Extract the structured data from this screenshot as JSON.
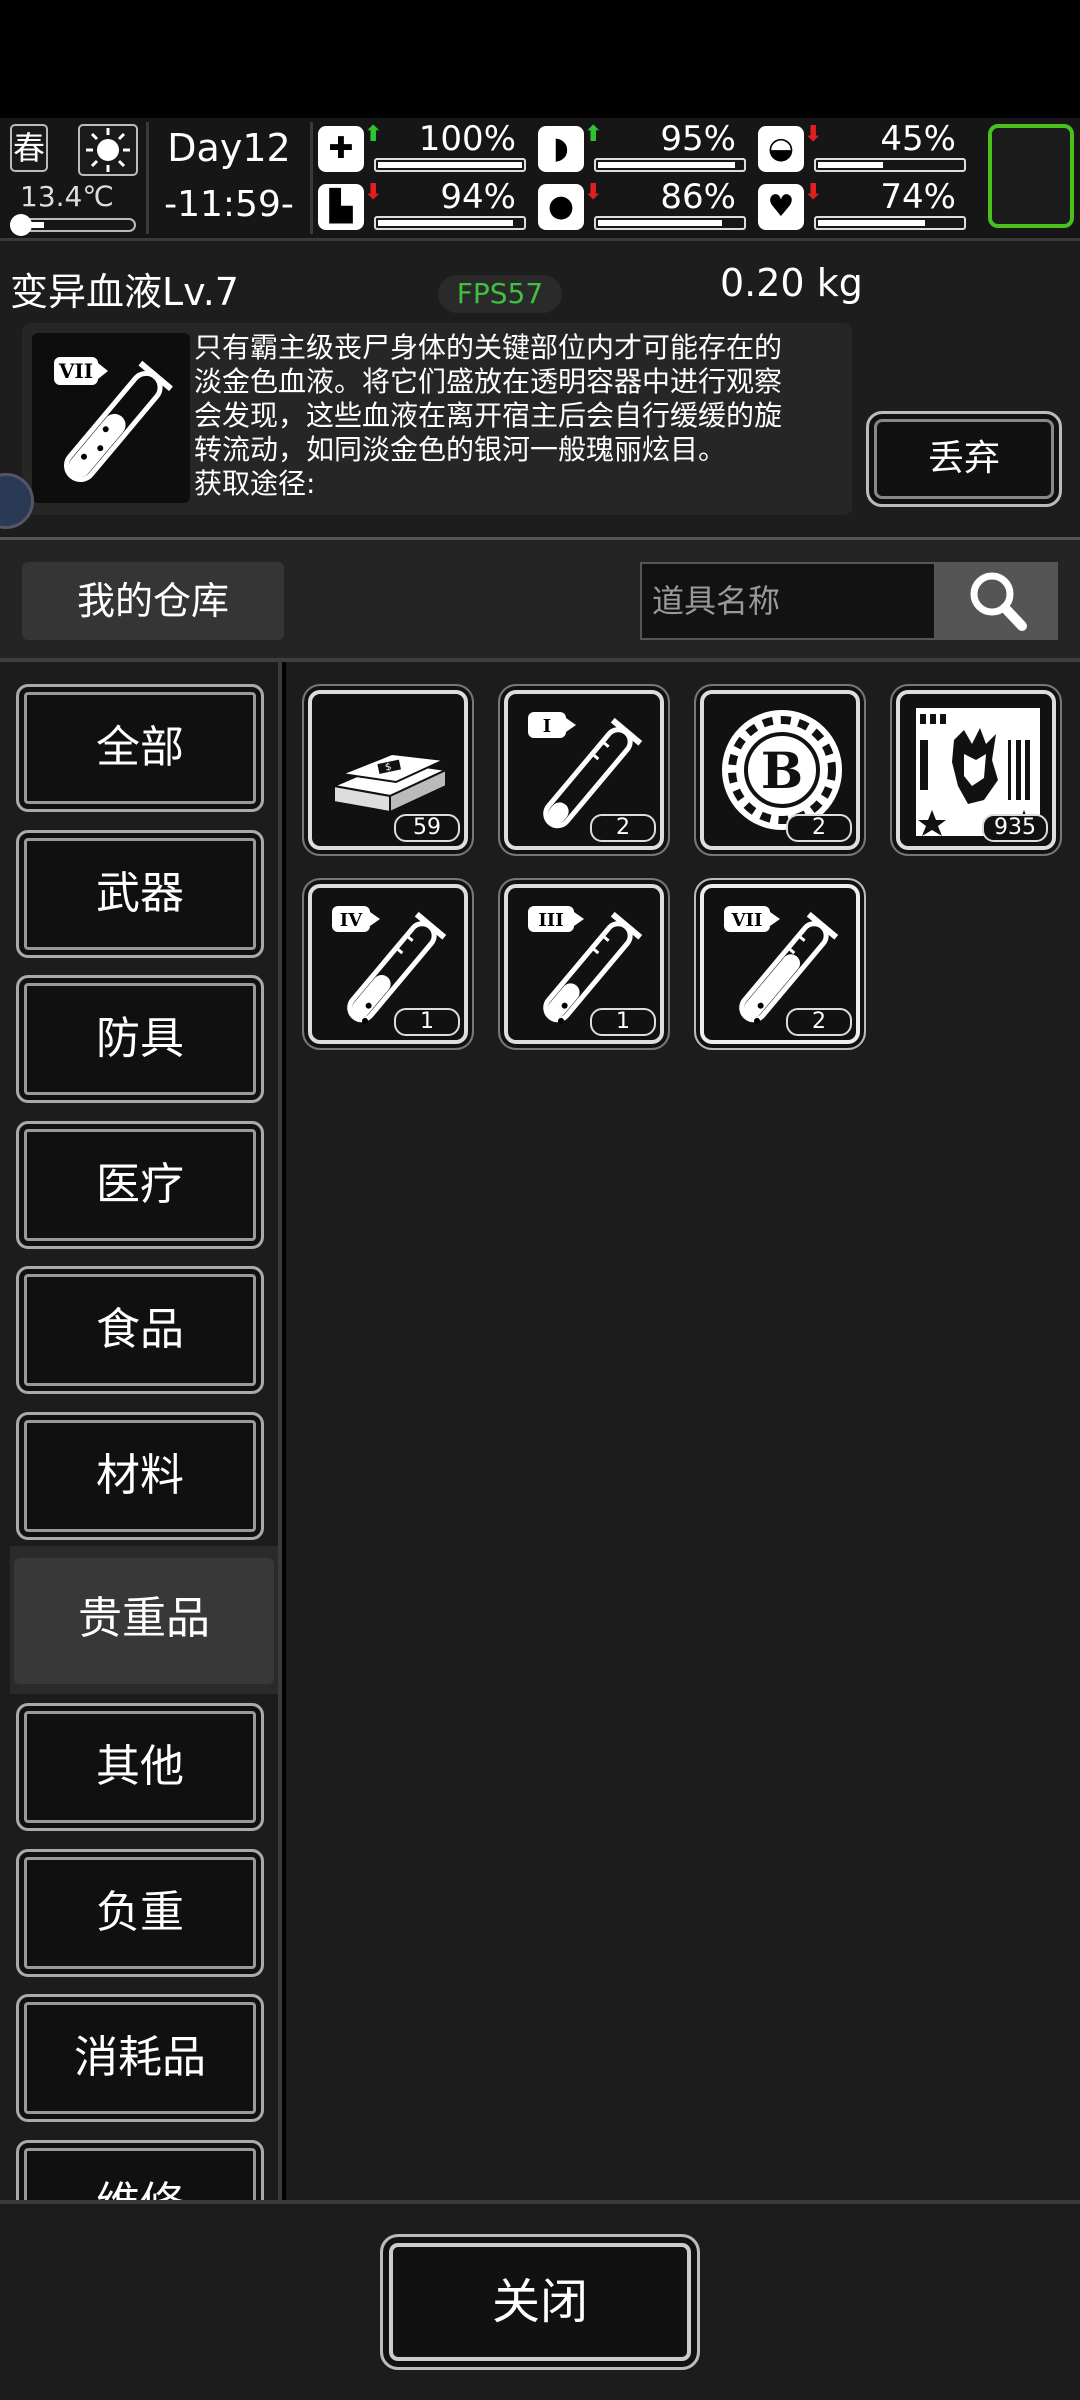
{
  "status": {
    "season": "春",
    "temperature": "13.4℃",
    "day": "Day12",
    "time": "-11:59-",
    "stats": [
      {
        "name": "health",
        "icon": "medkit-icon",
        "trend": "up",
        "value": "100%",
        "level": 1.0
      },
      {
        "name": "hunger",
        "icon": "stomach-icon",
        "trend": "up",
        "value": "95%",
        "level": 0.95
      },
      {
        "name": "stamina",
        "icon": "capsule-icon",
        "trend": "down",
        "value": "45%",
        "level": 0.45
      },
      {
        "name": "leg",
        "icon": "leg-icon",
        "trend": "down",
        "value": "94%",
        "level": 0.94
      },
      {
        "name": "thirst",
        "icon": "water-drop-icon",
        "trend": "down",
        "value": "86%",
        "level": 0.86
      },
      {
        "name": "mood",
        "icon": "heart-icon",
        "trend": "down",
        "value": "74%",
        "level": 0.74
      }
    ]
  },
  "detail": {
    "name": "变异血液Lv.7",
    "fps": "FPS57",
    "weight": "0.20 kg",
    "description_lines": [
      "只有霸主级丧尸身体的关键部位内才可能存在的",
      "淡金色血液。将它们盛放在透明容器中进行观察",
      "会发现，这些血液在离开宿主后会自行缓缓的旋",
      "转流动，如同淡金色的银河一般瑰丽炫目。",
      "获取途径:"
    ],
    "discard_label": "丢弃"
  },
  "storage": {
    "title": "我的仓库",
    "search_placeholder": "道具名称"
  },
  "categories": [
    {
      "label": "全部",
      "active": false
    },
    {
      "label": "武器",
      "active": false
    },
    {
      "label": "防具",
      "active": false
    },
    {
      "label": "医疗",
      "active": false
    },
    {
      "label": "食品",
      "active": false
    },
    {
      "label": "材料",
      "active": false
    },
    {
      "label": "贵重品",
      "active": true
    },
    {
      "label": "其他",
      "active": false
    },
    {
      "label": "负重",
      "active": false
    },
    {
      "label": "消耗品",
      "active": false
    },
    {
      "label": "维修",
      "active": false
    }
  ],
  "items": [
    {
      "icon": "cash-stack-icon",
      "count": "59"
    },
    {
      "icon": "blood-vial-1-icon",
      "roman": "I",
      "fill": 0.2,
      "count": "2"
    },
    {
      "icon": "bitcoin-chip-icon",
      "count": "2"
    },
    {
      "icon": "zombie-card-icon",
      "count": "935"
    },
    {
      "icon": "blood-vial-4-icon",
      "roman": "IV",
      "fill": 0.45,
      "count": "1"
    },
    {
      "icon": "blood-vial-3-icon",
      "roman": "III",
      "fill": 0.35,
      "count": "1"
    },
    {
      "icon": "blood-vial-7-icon",
      "roman": "VII",
      "fill": 0.7,
      "count": "2",
      "selected": true
    }
  ],
  "footer": {
    "close_label": "关闭"
  }
}
